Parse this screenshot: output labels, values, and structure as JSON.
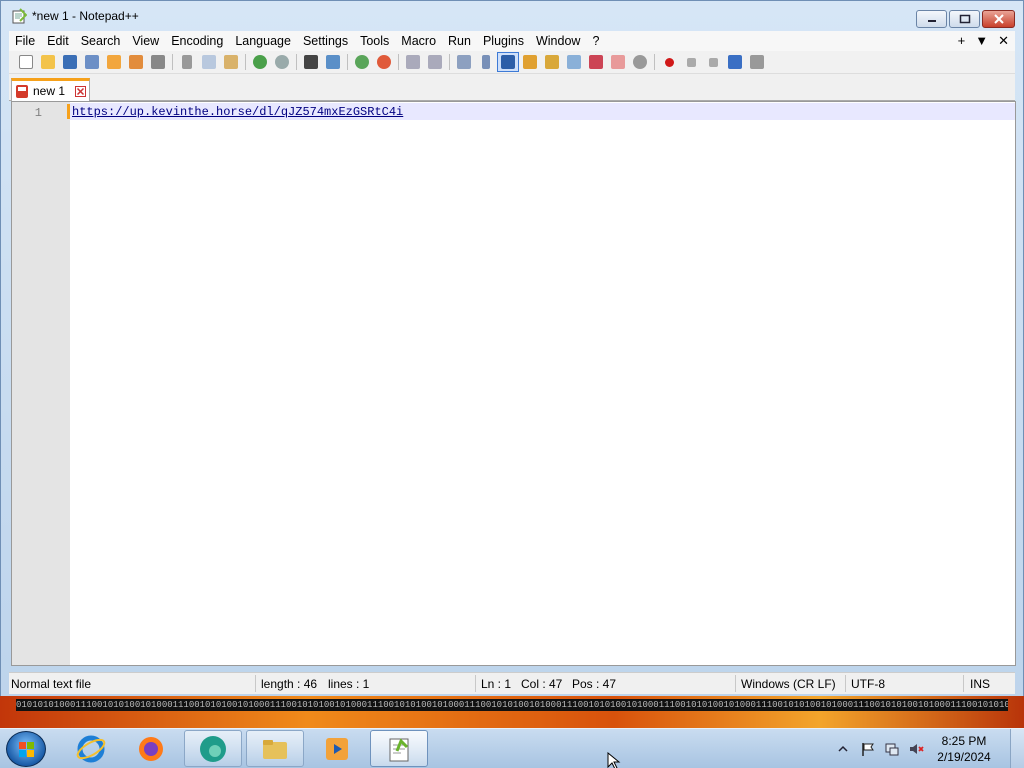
{
  "window": {
    "title": "*new 1 - Notepad++"
  },
  "menu": [
    "File",
    "Edit",
    "Search",
    "View",
    "Encoding",
    "Language",
    "Settings",
    "Tools",
    "Macro",
    "Run",
    "Plugins",
    "Window",
    "?"
  ],
  "menu_right": {
    "plus": "+",
    "dropdown": "▼",
    "close": "✕"
  },
  "toolbar_icons": [
    "new-file-icon",
    "open-file-icon",
    "save-icon",
    "save-all-icon",
    "close-icon",
    "close-all-icon",
    "print-icon",
    "cut-icon",
    "copy-icon",
    "paste-icon",
    "undo-icon",
    "redo-icon",
    "find-icon",
    "replace-icon",
    "zoom-in-icon",
    "zoom-out-icon",
    "sync-vertical-icon",
    "sync-horizontal-icon",
    "word-wrap-icon",
    "show-all-chars-icon",
    "indent-guide-icon",
    "user-language-icon",
    "doc-map-icon",
    "function-list-icon",
    "folder-as-workspace-icon",
    "doc-switcher-icon",
    "monitor-icon",
    "record-macro-icon",
    "stop-macro-icon",
    "play-macro-icon",
    "run-multiple-macro-icon",
    "save-macro-icon"
  ],
  "tab": {
    "label": "new 1"
  },
  "editor": {
    "line_number": "1",
    "content": "https://up.kevinthe.horse/dl/qJZ574mxEzGSRtC4i"
  },
  "status": {
    "file_type": "Normal text file",
    "length": "length : 46",
    "lines": "lines : 1",
    "ln": "Ln : 1",
    "col": "Col : 47",
    "pos": "Pos : 47",
    "eol": "Windows (CR LF)",
    "encoding": "UTF-8",
    "mode": "INS"
  },
  "desktop": {
    "binary": "0101010100011100101010010100011100101010010100011100101010010100011100101010010100011100101010010100011100101010010100011100101010010100011100101010010100011100101010010100011100101010010100011100101010"
  },
  "taskbar": {
    "apps": [
      "internet-explorer",
      "firefox",
      "edge",
      "file-explorer",
      "media-player",
      "notepad-plus-plus"
    ],
    "time": "8:25 PM",
    "date": "2/19/2024"
  },
  "colors": {
    "accent": "#f6a11b",
    "url": "#000080",
    "gutter": "#e4e4e4",
    "current_line": "#e8e8ff"
  }
}
